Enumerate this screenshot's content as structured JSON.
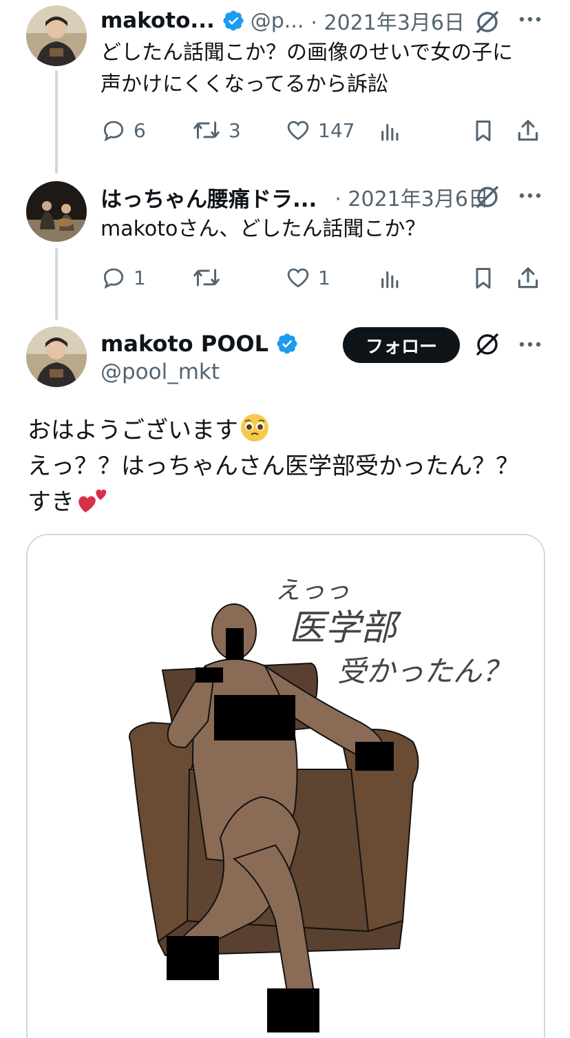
{
  "tweets": [
    {
      "name": "makoto...",
      "handle": "@p...",
      "date": "· 2021年3月6日",
      "text_lines": [
        "どしたん話聞こか？の画像のせいで女の子に",
        "声かけにくくなってるから訴訟"
      ],
      "replies": "6",
      "retweets": "3",
      "likes": "147"
    },
    {
      "name": "はっちゃん腰痛ドラ...",
      "date": "· 2021年3月6日",
      "text_lines": [
        "makotoさん、どしたん話聞こか？"
      ],
      "replies": "1",
      "retweets": "",
      "likes": "1"
    }
  ],
  "main": {
    "name": "makoto POOL",
    "handle": "@pool_mkt",
    "follow_label": "フォロー",
    "text_line1": "おはようございます",
    "text_line2": "えっ？？はっちゃんさん医学部受かったん？？",
    "text_line3": "すき",
    "image_caption_lines": [
      "えっっ",
      "医学部",
      "受かったん？"
    ]
  },
  "colors": {
    "verified": "#1d9bf0",
    "icon": "#536471",
    "thread_line": "#cfd9de",
    "follow_bg": "#0f1419"
  },
  "icons": [
    "reply-icon",
    "retweet-icon",
    "like-icon",
    "views-icon",
    "bookmark-icon",
    "share-icon",
    "grok-icon",
    "more-icon",
    "verified-icon"
  ]
}
